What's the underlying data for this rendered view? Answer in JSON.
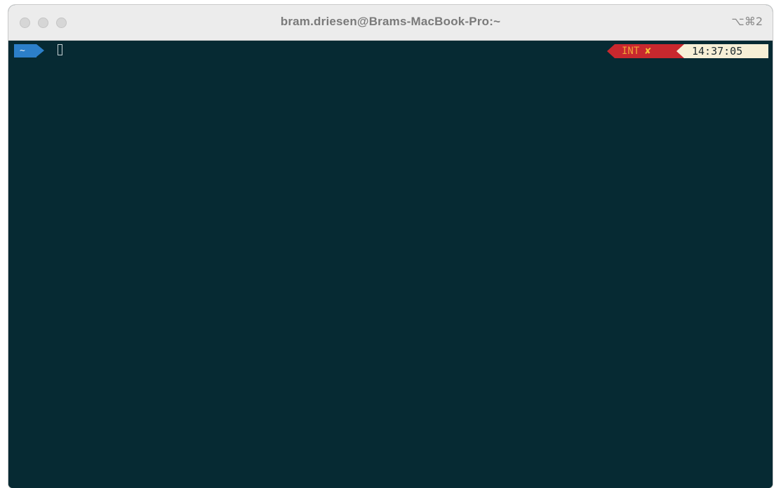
{
  "window": {
    "title": "bram.driesen@Brams-MacBook-Pro:~",
    "shortcut": "⌥⌘2"
  },
  "prompt": {
    "directory": "~"
  },
  "right_prompt": {
    "status": "INT",
    "status_icon": "✘",
    "time": "14:37:05"
  },
  "colors": {
    "terminal_bg": "#062a33",
    "dir_segment": "#2c7fc9",
    "status_segment": "#c8282e",
    "status_text": "#f0a33a",
    "time_segment": "#f6efd6"
  }
}
